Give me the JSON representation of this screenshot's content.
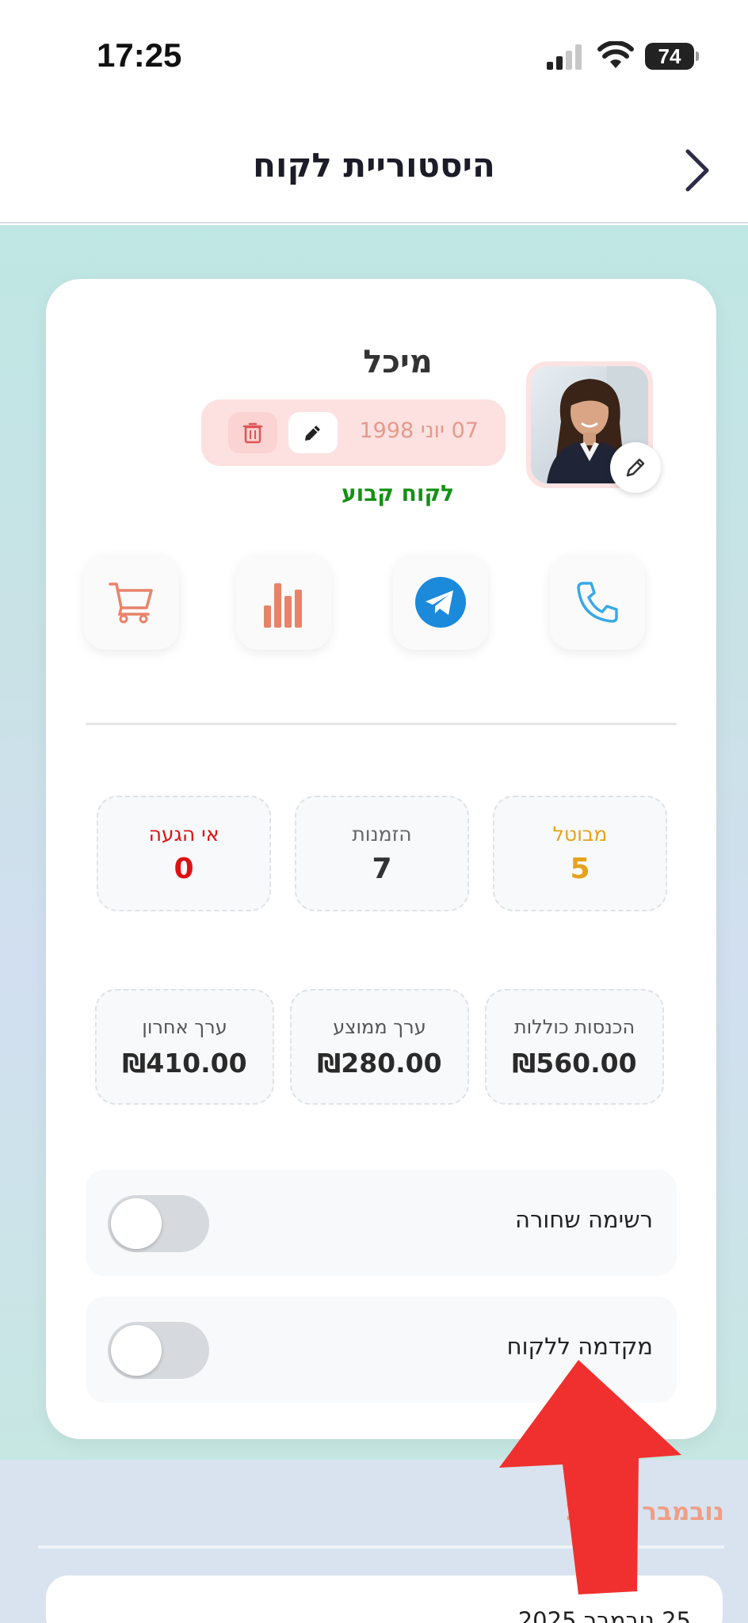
{
  "status_bar": {
    "time": "17:25",
    "battery": "74"
  },
  "header": {
    "title": "היסטוריית לקוח"
  },
  "profile": {
    "name": "מיכל",
    "birth_date": "07 יוני 1998",
    "status": "לקוח קבוע",
    "status_color": "#159115"
  },
  "actions": [
    "phone-icon",
    "telegram-icon",
    "bar-chart-icon",
    "cart-icon"
  ],
  "stats": [
    {
      "label": "מבוטל",
      "value": "5",
      "color": "#e6a31a"
    },
    {
      "label": "הזמנות",
      "value": "7",
      "color": "#333333"
    },
    {
      "label": "אי הגעה",
      "value": "0",
      "color": "#dd1111"
    }
  ],
  "money": [
    {
      "label": "הכנסות כוללות",
      "value": "₪560.00"
    },
    {
      "label": "ערך ממוצע",
      "value": "₪280.00"
    },
    {
      "label": "ערך אחרון",
      "value": "₪410.00"
    }
  ],
  "settings": [
    {
      "label": "רשימה שחורה",
      "enabled": false
    },
    {
      "label": "מקדמה ללקוח",
      "enabled": false
    }
  ],
  "history": {
    "month": "נובמבר 2025",
    "first_entry_date": "25 נובמבר 2025"
  },
  "colors": {
    "accent": "#ef9e86",
    "annotation_arrow": "#f0302f"
  }
}
